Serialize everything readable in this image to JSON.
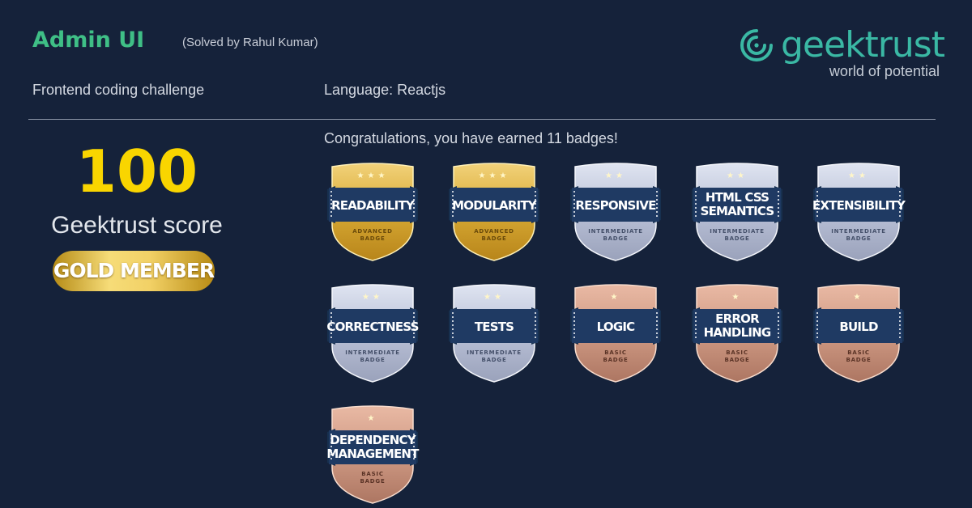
{
  "header": {
    "title": "Admin UI",
    "solved_by": "(Solved by Rahul Kumar)",
    "subtitle": "Frontend coding challenge",
    "language": "Language: Reactjs"
  },
  "logo": {
    "name": "geektrust",
    "tagline": "world of potential",
    "icon": "geektrust-logo-icon"
  },
  "score": {
    "value": "100",
    "label": "Geektrust score",
    "membership": "GOLD MEMBER"
  },
  "congrats": "Congratulations, you have earned 11 badges!",
  "colors": {
    "accent_green": "#3fbf86",
    "score_yellow": "#f9d500",
    "background": "#15223a",
    "gold": "#e3b53a",
    "silver": "#c4cbdf",
    "bronze": "#d09c86",
    "ribbon": "#1f3a63"
  },
  "badges": [
    {
      "name": "READABILITY",
      "lines": [
        "READABILITY"
      ],
      "tier": "gold",
      "stars": 3,
      "level": [
        "ADVANCED",
        "BADGE"
      ]
    },
    {
      "name": "MODULARITY",
      "lines": [
        "MODULARITY"
      ],
      "tier": "gold",
      "stars": 3,
      "level": [
        "ADVANCED",
        "BADGE"
      ]
    },
    {
      "name": "RESPONSIVE",
      "lines": [
        "RESPONSIVE"
      ],
      "tier": "silver",
      "stars": 2,
      "level": [
        "INTERMEDIATE",
        "BADGE"
      ]
    },
    {
      "name": "HTML CSS SEMANTICS",
      "lines": [
        "HTML CSS",
        "SEMANTICS"
      ],
      "tier": "silver",
      "stars": 2,
      "level": [
        "INTERMEDIATE",
        "BADGE"
      ]
    },
    {
      "name": "EXTENSIBILITY",
      "lines": [
        "EXTENSIBILITY"
      ],
      "tier": "silver",
      "stars": 2,
      "level": [
        "INTERMEDIATE",
        "BADGE"
      ]
    },
    {
      "name": "CORRECTNESS",
      "lines": [
        "CORRECTNESS"
      ],
      "tier": "silver",
      "stars": 2,
      "level": [
        "INTERMEDIATE",
        "BADGE"
      ]
    },
    {
      "name": "TESTS",
      "lines": [
        "TESTS"
      ],
      "tier": "silver",
      "stars": 2,
      "level": [
        "INTERMEDIATE",
        "BADGE"
      ]
    },
    {
      "name": "LOGIC",
      "lines": [
        "LOGIC"
      ],
      "tier": "bronze",
      "stars": 1,
      "level": [
        "BASIC",
        "BADGE"
      ]
    },
    {
      "name": "ERROR HANDLING",
      "lines": [
        "ERROR",
        "HANDLING"
      ],
      "tier": "bronze",
      "stars": 1,
      "level": [
        "BASIC",
        "BADGE"
      ]
    },
    {
      "name": "BUILD",
      "lines": [
        "BUILD"
      ],
      "tier": "bronze",
      "stars": 1,
      "level": [
        "BASIC",
        "BADGE"
      ]
    },
    {
      "name": "DEPENDENCY MANAGEMENT",
      "lines": [
        "DEPENDENCY",
        "MANAGEMENT"
      ],
      "tier": "bronze",
      "stars": 1,
      "level": [
        "BASIC",
        "BADGE"
      ]
    }
  ]
}
